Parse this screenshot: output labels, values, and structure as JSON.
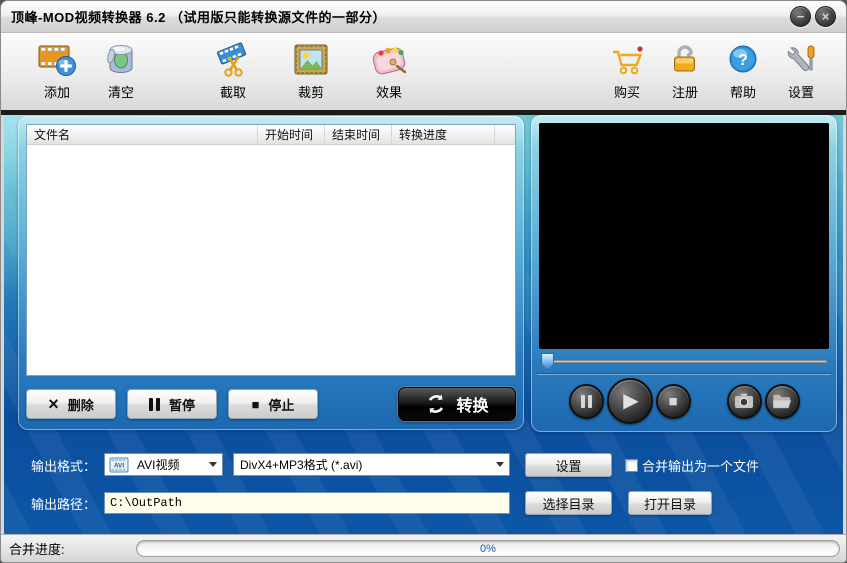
{
  "window": {
    "title": "顶峰-MOD视频转换器 6.2 （试用版只能转换源文件的一部分）",
    "minimize_glyph": "−",
    "close_glyph": "×"
  },
  "toolbar": {
    "items": [
      {
        "label": "添加",
        "icon": "add-media-icon"
      },
      {
        "label": "清空",
        "icon": "clear-list-icon"
      },
      {
        "label": "截取",
        "icon": "clip-scissors-icon"
      },
      {
        "label": "裁剪",
        "icon": "crop-frame-icon"
      },
      {
        "label": "效果",
        "icon": "effect-palette-icon"
      },
      {
        "label": "购买",
        "icon": "buy-cart-icon"
      },
      {
        "label": "注册",
        "icon": "register-lock-icon"
      },
      {
        "label": "帮助",
        "icon": "help-icon"
      },
      {
        "label": "设置",
        "icon": "settings-tools-icon"
      }
    ],
    "help_glyph": "?"
  },
  "file_list": {
    "columns": [
      "文件名",
      "开始时间",
      "结束时间",
      "转换进度"
    ],
    "rows": []
  },
  "list_actions": {
    "delete": "删除",
    "pause": "暂停",
    "stop": "停止",
    "convert": "转换",
    "delete_glyph": "×",
    "stop_glyph": "■"
  },
  "player": {
    "slider_percent": 0,
    "play_glyph": "▶",
    "stop_glyph": "■"
  },
  "output_format": {
    "label": "输出格式：",
    "format_type": "AVI视频",
    "avi_badge": "AVI",
    "format_detail": "DivX4+MP3格式 (*.avi)",
    "settings_button": "设置",
    "merge_checkbox_label": "合并输出为一个文件",
    "merge_checked": false
  },
  "output_path": {
    "label": "输出路径：",
    "value": "C:\\OutPath",
    "choose_button": "选择目录",
    "open_button": "打开目录"
  },
  "status_bar": {
    "label": "合并进度:",
    "progress_text": "0%",
    "progress_percent": 0
  },
  "colors": {
    "teal_top": "#6cc6d4",
    "deep_blue": "#0b4d9d",
    "titlebar_bg": "#e8e8e8",
    "path_field_bg": "#fdfde9",
    "progress_text": "#1a5fa8",
    "convert_button_bg": "#111111"
  }
}
